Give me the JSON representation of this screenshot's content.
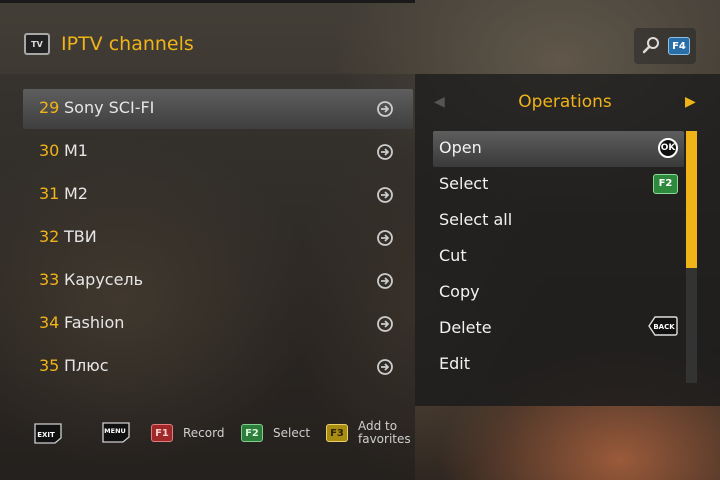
{
  "header": {
    "tv_icon_label": "TV",
    "title": "IPTV channels",
    "search_key": "F4"
  },
  "channels": [
    {
      "number": "29",
      "name": "Sony SCI-FI",
      "selected": true
    },
    {
      "number": "30",
      "name": "M1"
    },
    {
      "number": "31",
      "name": "M2"
    },
    {
      "number": "32",
      "name": "ТВИ"
    },
    {
      "number": "33",
      "name": "Карусель"
    },
    {
      "number": "34",
      "name": "Fashion"
    },
    {
      "number": "35",
      "name": "Плюс"
    }
  ],
  "operations": {
    "title": "Operations",
    "items": [
      {
        "label": "Open",
        "key": "OK",
        "selected": true
      },
      {
        "label": "Select",
        "key": "F2"
      },
      {
        "label": "Select all"
      },
      {
        "label": "Cut"
      },
      {
        "label": "Copy"
      },
      {
        "label": "Delete",
        "key": "BACK"
      },
      {
        "label": "Edit"
      }
    ]
  },
  "footer": {
    "exit_key": "EXIT",
    "menu_key": "MENU",
    "f1_key": "F1",
    "f1_label": "Record",
    "f2_key": "F2",
    "f2_label": "Select",
    "f3_key": "F3",
    "f3_label_line1": "Add to",
    "f3_label_line2": "favorites"
  },
  "colors": {
    "accent": "#f0b419",
    "f1": "#a12828",
    "f2": "#2d7e3a",
    "f3": "#a88c12",
    "f4": "#2a6ea8"
  }
}
